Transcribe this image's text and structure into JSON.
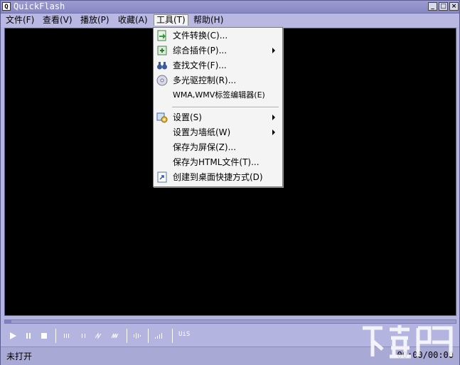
{
  "app": {
    "title": "QuickFlash",
    "icon_letter": "Q"
  },
  "window_buttons": {
    "minimize": "_",
    "maximize": "□",
    "close": "×"
  },
  "menubar": {
    "items": [
      {
        "label": "文件(F)"
      },
      {
        "label": "查看(V)"
      },
      {
        "label": "播放(P)"
      },
      {
        "label": "收藏(A)"
      },
      {
        "label": "工具(T)"
      },
      {
        "label": "帮助(H)"
      }
    ]
  },
  "tools_menu": {
    "items": [
      {
        "label": "文件转换(C)...",
        "icon": "file-convert-icon"
      },
      {
        "label": "综合插件(P)...",
        "icon": "plugin-icon",
        "submenu": true
      },
      {
        "label": "查找文件(F)...",
        "icon": "binoculars-icon"
      },
      {
        "label": "多光驱控制(R)...",
        "icon": "cd-icon"
      },
      {
        "label": "WMA,WMV标签编辑器(E)"
      },
      {
        "label": "设置(S)",
        "icon": "settings-icon",
        "submenu": true
      },
      {
        "label": "设置为墙纸(W)",
        "submenu": true
      },
      {
        "label": "保存为屏保(Z)..."
      },
      {
        "label": "保存为HTML文件(T)..."
      },
      {
        "label": "创建到桌面快捷方式(D)",
        "icon": "shortcut-icon"
      }
    ]
  },
  "controls": {
    "uis_label": "UiS"
  },
  "status": {
    "text": "未打开",
    "time": "00:00/00:00"
  },
  "colors": {
    "frame": "#b4b4e0",
    "video": "#000000",
    "menu_bg": "#f4f4f4"
  }
}
